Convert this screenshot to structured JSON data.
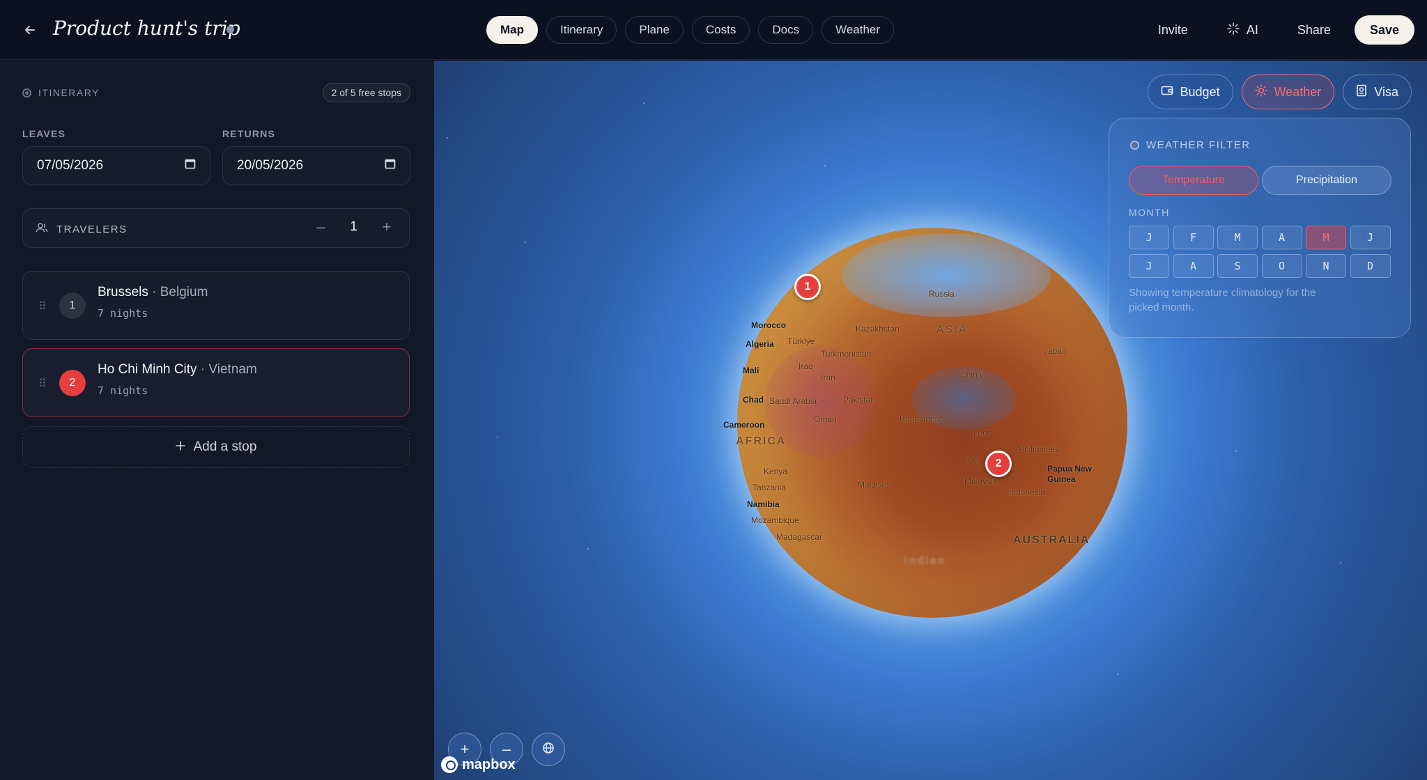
{
  "header": {
    "title": "Product hunt's trip",
    "tabs": [
      {
        "label": "Map",
        "active": true
      },
      {
        "label": "Itinerary",
        "active": false
      },
      {
        "label": "Plane",
        "active": false
      },
      {
        "label": "Costs",
        "active": false
      },
      {
        "label": "Docs",
        "active": false
      },
      {
        "label": "Weather",
        "active": false
      }
    ],
    "actions": {
      "invite": "Invite",
      "ai": "AI",
      "share": "Share",
      "save": "Save"
    }
  },
  "itinerary": {
    "heading": "ITINERARY",
    "free_stops": "2 of 5 free stops",
    "leaves_label": "LEAVES",
    "leaves_value": "07/05/2026",
    "returns_label": "RETURNS",
    "returns_value": "20/05/2026",
    "travelers_label": "TRAVELERS",
    "travelers_count": "1",
    "stops": [
      {
        "number": "1",
        "city": "Brussels",
        "country": "· Belgium",
        "nights": "7 nights"
      },
      {
        "number": "2",
        "city": "Ho Chi Minh City",
        "country": "· Vietnam",
        "nights": "7 nights"
      }
    ],
    "add_stop": "Add a stop"
  },
  "map": {
    "layers": {
      "budget": "Budget",
      "weather": "Weather",
      "visa": "Visa"
    },
    "weather_filter": {
      "title": "WEATHER FILTER",
      "temperature": "Temperature",
      "precipitation": "Precipitation",
      "month_label": "MONTH",
      "months": [
        "J",
        "F",
        "M",
        "A",
        "M",
        "J",
        "J",
        "A",
        "S",
        "O",
        "N",
        "D"
      ],
      "selected_month_index": 4,
      "note": "Showing temperature climatology for the picked month."
    },
    "markers": [
      "1",
      "2"
    ],
    "labels": {
      "russia": "Russia",
      "kazakhstan": "Kazakhstan",
      "asia": "ASIA",
      "turkiye": "Türkiye",
      "turkmenistan": "Turkmenistan",
      "iraq": "Iraq",
      "iran": "Iran",
      "china": "China",
      "japan": "Japan",
      "saudi": "Saudi Arabia",
      "pakistan": "Pakistan",
      "oman": "Oman",
      "bangladesh": "Bangladesh",
      "laos": "Laos",
      "philippines": "Philippines",
      "cambodia": "Ca",
      "malaysia": "Malaysia",
      "indonesia": "Indonesia",
      "png": "Papua New Guinea",
      "maldives": "Maldives",
      "morocco": "Morocco",
      "algeria": "Algeria",
      "mali": "Mali",
      "chad": "Chad",
      "cameroon": "Cameroon",
      "africa": "AFRICA",
      "kenya": "Kenya",
      "tanzania": "Tanzania",
      "namibia": "Namibia",
      "mozambique": "Mozambique",
      "madagascar": "Madagascar",
      "australia": "AUSTRALIA",
      "indian": "Indian"
    },
    "attribution": "mapbox"
  }
}
